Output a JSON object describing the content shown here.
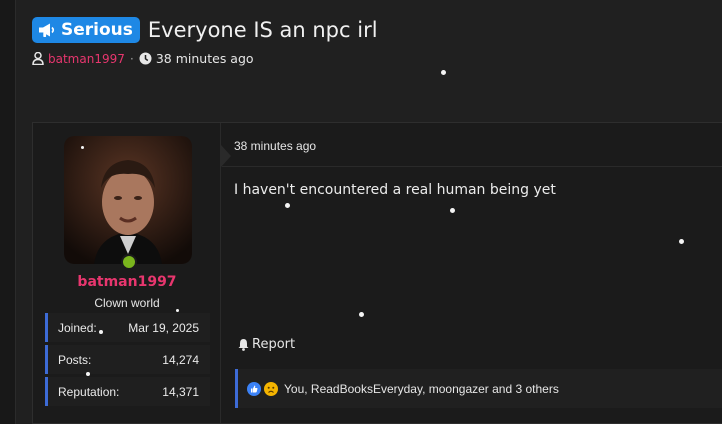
{
  "thread": {
    "prefix": "Serious",
    "prefix_icon": "megaphone-icon",
    "title": "Everyone IS an npc irl",
    "author": "batman1997",
    "separator": "·",
    "time": "38 minutes ago"
  },
  "post": {
    "author": {
      "username": "batman1997",
      "user_title": "Clown world",
      "online": true,
      "stats": [
        {
          "label": "Joined:",
          "value": "Mar 19, 2025"
        },
        {
          "label": "Posts:",
          "value": "14,274"
        },
        {
          "label": "Reputation:",
          "value": "14,371"
        }
      ]
    },
    "time": "38 minutes ago",
    "body": "I haven't encountered a real human being yet",
    "report_label": "Report",
    "reactions": {
      "icons": [
        "like-icon",
        "sad-icon"
      ],
      "text": "You, ReadBooksEveryday, moongazer and 3 others"
    }
  },
  "colors": {
    "background": "#202020",
    "accent": "#1e88e5",
    "username": "#e8366e",
    "online": "#7ab51d",
    "stat_border": "#3d6bd6"
  }
}
